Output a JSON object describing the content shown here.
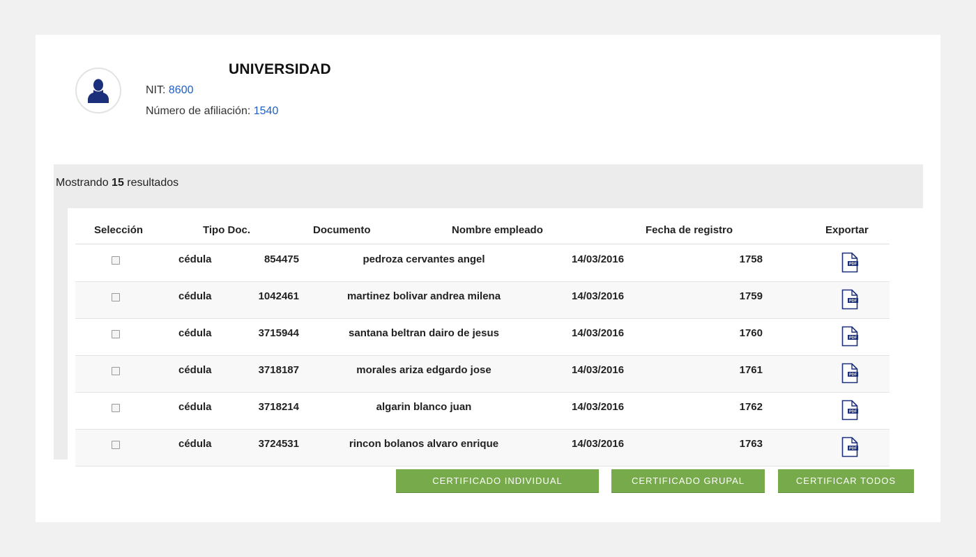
{
  "header": {
    "title": "UNIVERSIDAD",
    "nit_label": "NIT: ",
    "nit_value": "8600",
    "affiliation_label": "Número de afiliación: ",
    "affiliation_value": "1540"
  },
  "results": {
    "prefix": "Mostrando ",
    "count": "15",
    "suffix": " resultados"
  },
  "table": {
    "columns": [
      "Selección",
      "Tipo Doc.",
      "Documento",
      "Nombre empleado",
      "Fecha de registro",
      "Exportar"
    ],
    "rows": [
      {
        "tipo": "cédula",
        "documento": "854475",
        "nombre": "pedroza cervantes angel",
        "fecha": "14/03/2016",
        "numero": "1758"
      },
      {
        "tipo": "cédula",
        "documento": "1042461",
        "nombre": "martinez bolivar andrea milena",
        "fecha": "14/03/2016",
        "numero": "1759"
      },
      {
        "tipo": "cédula",
        "documento": "3715944",
        "nombre": "santana beltran dairo de jesus",
        "fecha": "14/03/2016",
        "numero": "1760"
      },
      {
        "tipo": "cédula",
        "documento": "3718187",
        "nombre": "morales ariza edgardo jose",
        "fecha": "14/03/2016",
        "numero": "1761"
      },
      {
        "tipo": "cédula",
        "documento": "3718214",
        "nombre": "algarin blanco juan",
        "fecha": "14/03/2016",
        "numero": "1762"
      },
      {
        "tipo": "cédula",
        "documento": "3724531",
        "nombre": "rincon bolanos alvaro enrique",
        "fecha": "14/03/2016",
        "numero": "1763"
      }
    ],
    "export_icon": "pdf-file-icon",
    "pdf_text": "PDF"
  },
  "buttons": {
    "individual": "CERTIFICADO INDIVIDUAL",
    "grupal": "CERTIFICADO GRUPAL",
    "todos": "CERTIFICAR TODOS"
  },
  "colors": {
    "link_blue": "#1d5fc7",
    "button_green": "#77aa4a",
    "icon_navy": "#1b2f7a"
  }
}
